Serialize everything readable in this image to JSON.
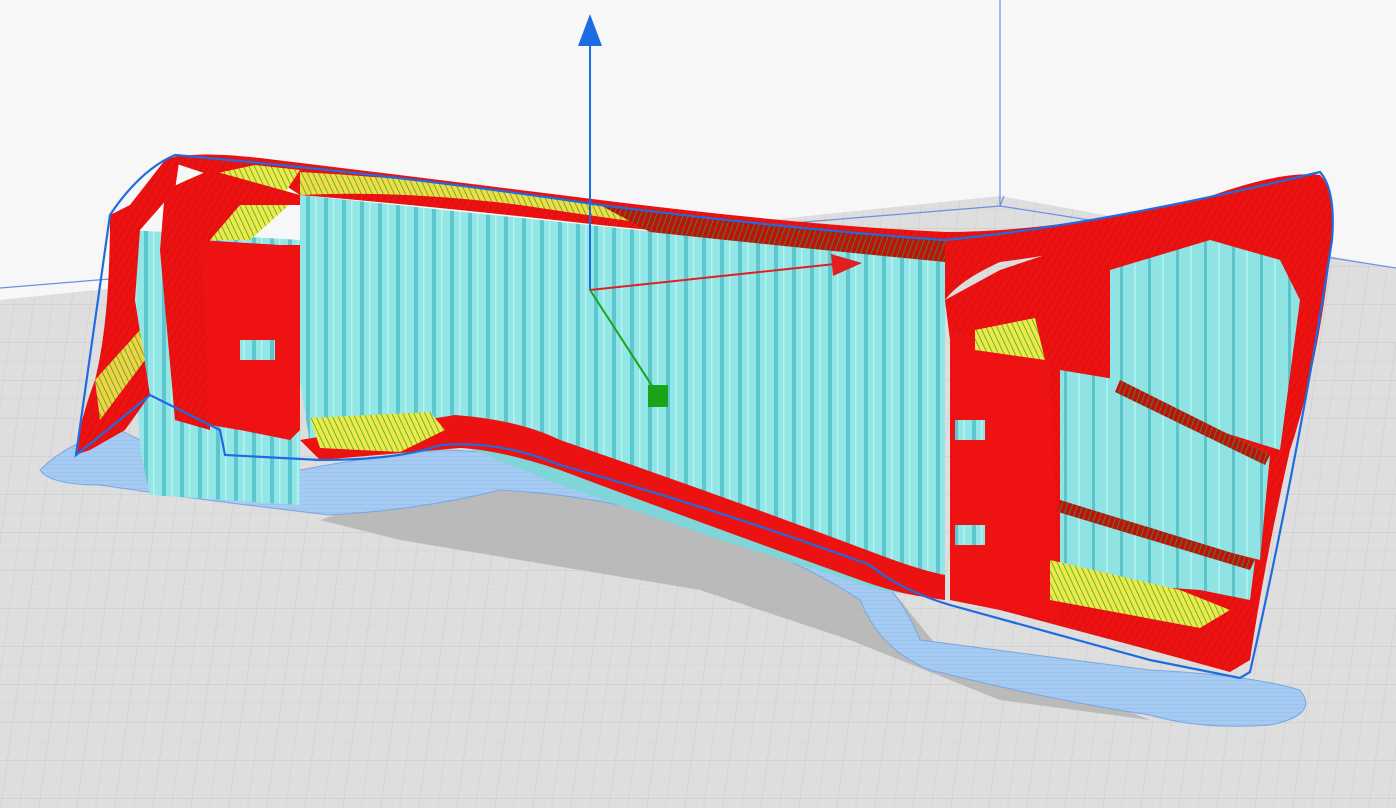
{
  "viewport": {
    "title": "",
    "colors": {
      "background": "#f7f7f7",
      "build_plate": "#dcdcdc",
      "grid_line": "#c6c6c6",
      "build_volume_edge": "#6f8fe0",
      "support": "#8fe3e3",
      "support_dark": "#55bcc6",
      "wall_outer": "#ee1111",
      "top_bottom_skin": "#f3f04a",
      "infill": "#2fb52f",
      "skirt_brim": "#9ec8f3",
      "shadow": "#b2b2b2",
      "axis_x": "#e02020",
      "axis_y": "#1aa41a",
      "axis_z": "#1a6de5"
    },
    "axes_gizmo": {
      "icon_x": "x-axis-arrow-icon",
      "icon_y": "y-axis-handle-icon",
      "icon_z": "z-axis-arrow-icon"
    },
    "model": {
      "icon": "sliced-layer-view-model",
      "view_mode": "layer-view"
    }
  }
}
